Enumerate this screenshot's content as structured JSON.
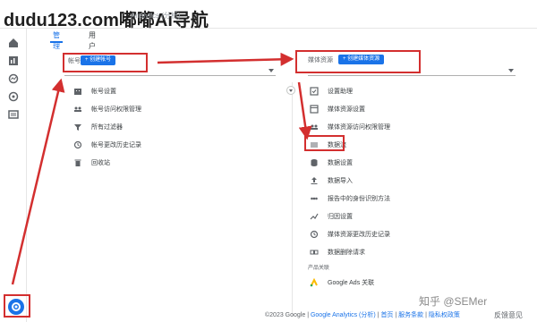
{
  "watermark": "dudu123.com嘟嘟Ai导航",
  "header_faint": "Analytics (分析)",
  "tabs": [
    {
      "label": "管理"
    },
    {
      "label": "用户"
    }
  ],
  "account": {
    "label": "帐号",
    "create_button": "+ 创建帐号"
  },
  "property": {
    "label": "媒体资源",
    "create_button": "+ 创建媒体资源"
  },
  "account_items": [
    {
      "label": "帐号设置",
      "icon": "building-icon"
    },
    {
      "label": "帐号访问权限管理",
      "icon": "people-icon"
    },
    {
      "label": "所有过滤器",
      "icon": "filter-icon"
    },
    {
      "label": "帐号更改历史记录",
      "icon": "history-icon"
    },
    {
      "label": "回收站",
      "icon": "trash-icon"
    }
  ],
  "property_items": [
    {
      "label": "设置助理",
      "icon": "checkbox-icon"
    },
    {
      "label": "媒体资源设置",
      "icon": "property-settings-icon"
    },
    {
      "label": "媒体资源访问权限管理",
      "icon": "people-icon"
    },
    {
      "label": "数据流",
      "icon": "data-stream-icon"
    },
    {
      "label": "数据设置",
      "icon": "database-icon"
    },
    {
      "label": "数据导入",
      "icon": "upload-icon"
    },
    {
      "label": "报告中的身份识别方法",
      "icon": "identity-icon"
    },
    {
      "label": "归因设置",
      "icon": "attribution-icon"
    },
    {
      "label": "媒体资源更改历史记录",
      "icon": "history-icon"
    },
    {
      "label": "数据删除请求",
      "icon": "dd-icon"
    }
  ],
  "product_links": {
    "heading": "产品关联",
    "google_ads": "Google Ads 关联"
  },
  "footer": {
    "copyright": "©2023 Google",
    "analytics": "Google Analytics (分析)",
    "home": "首页",
    "tos": "服务条款",
    "privacy": "隐私权政策"
  },
  "feedback": "反馈意见",
  "zhihu_mark": "知乎 @SEMer",
  "colors": {
    "accent": "#1a73e8",
    "highlight": "#d32f2f"
  }
}
